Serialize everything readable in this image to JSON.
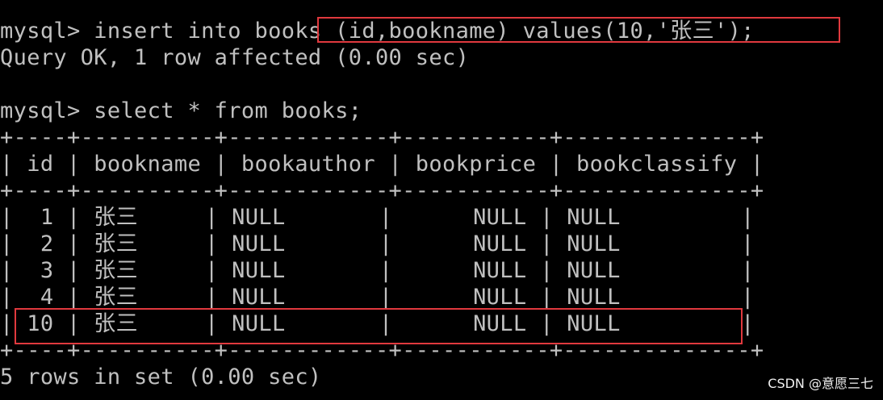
{
  "terminal": {
    "lines": [
      "mysql> insert into books (id,bookname) values(10,'张三');",
      "Query OK, 1 row affected (0.00 sec)",
      "",
      "mysql> select * from books;",
      "+----+----------+------------+-----------+--------------+",
      "| id | bookname | bookauthor | bookprice | bookclassify |",
      "+----+----------+------------+-----------+--------------+",
      "|  1 | 张三     | NULL       |      NULL | NULL         |",
      "|  2 | 张三     | NULL       |      NULL | NULL         |",
      "|  3 | 张三     | NULL       |      NULL | NULL         |",
      "|  4 | 张三     | NULL       |      NULL | NULL         |",
      "| 10 | 张三     | NULL       |      NULL | NULL         |",
      "+----+----------+------------+-----------+--------------+",
      "5 rows in set (0.00 sec)"
    ]
  },
  "watermark": "CSDN @意愿三七",
  "colors": {
    "background": "#000000",
    "text": "#c0c0c0",
    "highlight": "#e0393e"
  }
}
